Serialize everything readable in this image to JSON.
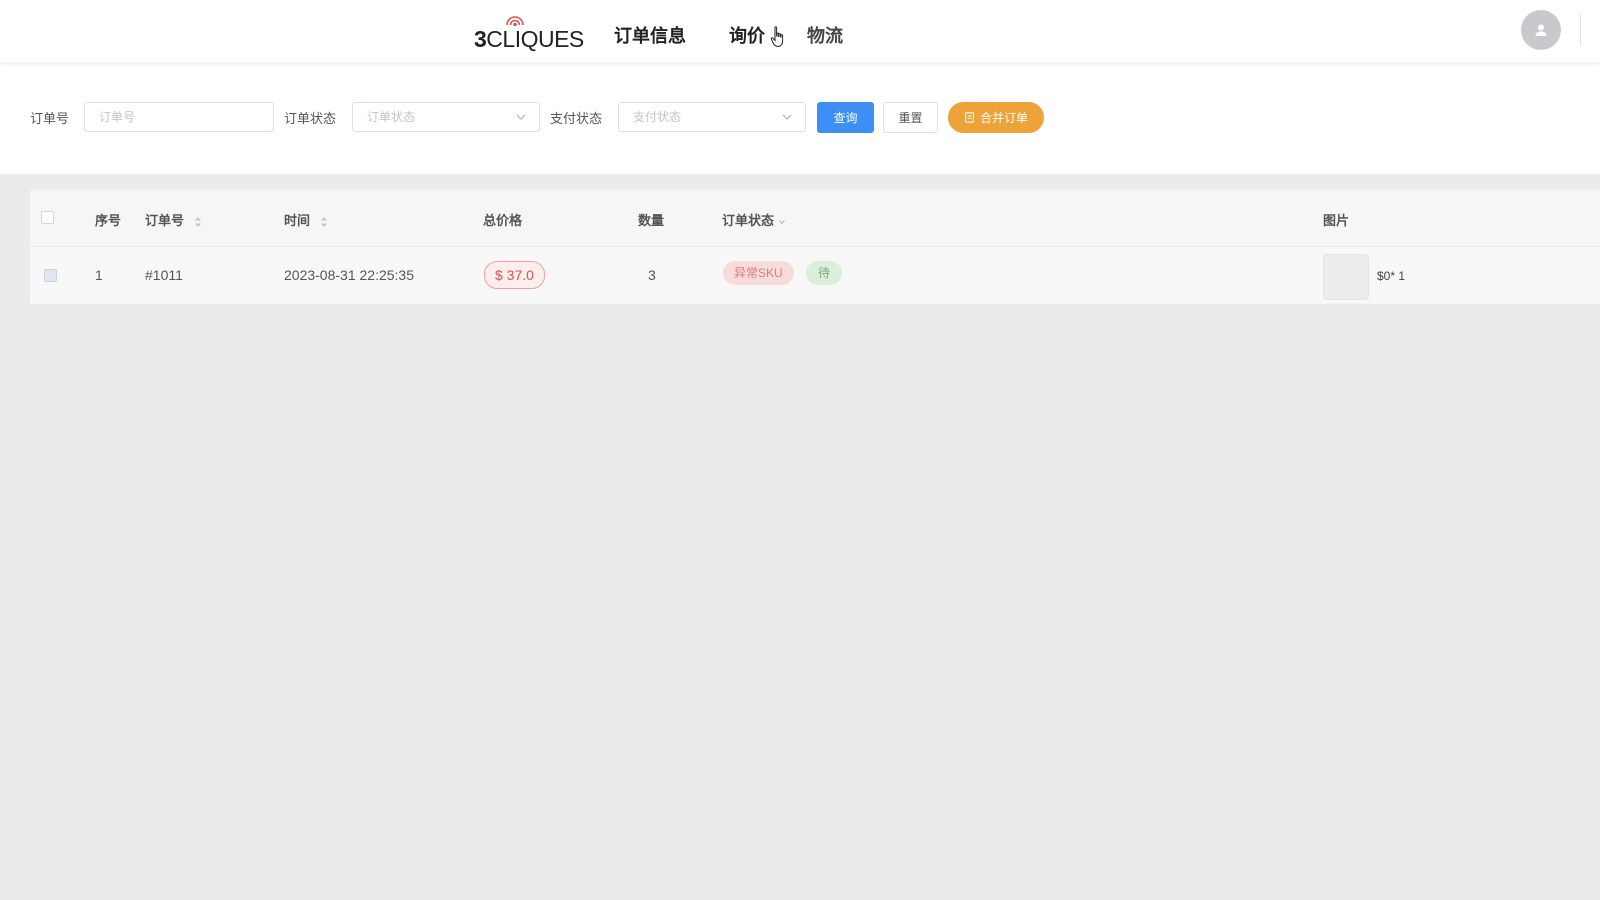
{
  "header": {
    "logo": {
      "prefix": "3",
      "text": "CLIQUES",
      "accent_color": "#d9534f"
    },
    "nav": [
      {
        "label": "订单信息"
      },
      {
        "label": "询价"
      },
      {
        "label": "物流"
      }
    ],
    "avatar_icon": "user-icon"
  },
  "filters": {
    "order_no": {
      "label": "订单号",
      "placeholder": "订单号",
      "value": ""
    },
    "order_status": {
      "label": "订单状态",
      "placeholder": "订单状态"
    },
    "pay_status": {
      "label": "支付状态",
      "placeholder": "支付状态"
    },
    "search_button": "查询",
    "reset_button": "重置",
    "merge_button": "合并订单",
    "colors": {
      "primary": "#3d8ff5",
      "warning": "#eda23a"
    }
  },
  "table": {
    "columns": [
      "序号",
      "订单号",
      "时间",
      "总价格",
      "数量",
      "订单状态",
      "图片"
    ],
    "rows": [
      {
        "index": "1",
        "order_no": "#1011",
        "time": "2023-08-31 22:25:35",
        "total_price": "$ 37.0",
        "quantity": "3",
        "status_tags": [
          "异常SKU",
          "待"
        ],
        "image_caption": "$0* 1"
      }
    ]
  }
}
